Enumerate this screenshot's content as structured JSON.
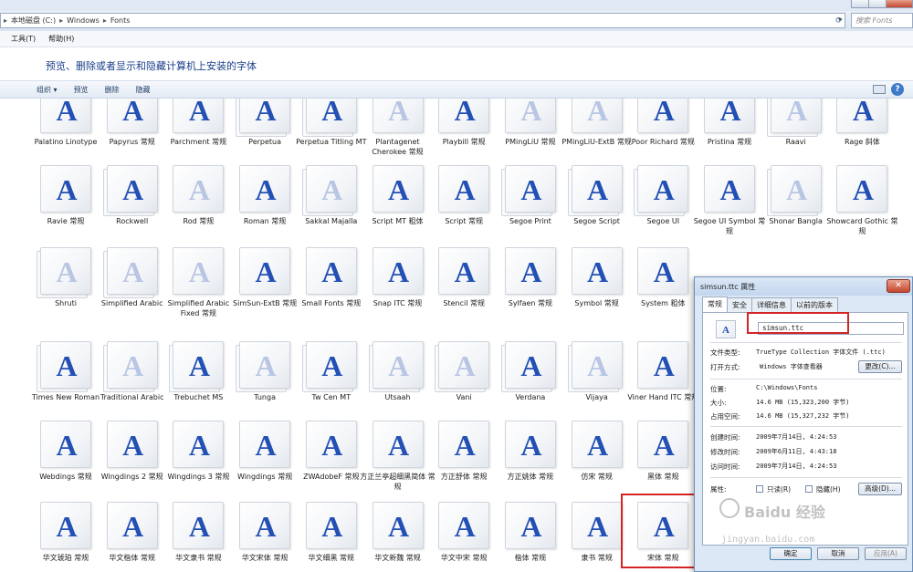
{
  "address": {
    "crumbs": [
      "本地磁盘 (C:)",
      "Windows",
      "Fonts"
    ],
    "search_placeholder": "搜索 Fonts"
  },
  "menu": [
    "工具(T)",
    "帮助(H)"
  ],
  "page_title": "预览、删除或者显示和隐藏计算机上安装的字体",
  "toolbar": {
    "organize": "组织 ▾",
    "preview": "预览",
    "delete": "删除",
    "hide": "隐藏",
    "help": "?"
  },
  "fonts": [
    {
      "name": "Palatino Linotype",
      "stack": false,
      "faded": false
    },
    {
      "name": "Papyrus 常规",
      "stack": false,
      "faded": false
    },
    {
      "name": "Parchment 常规",
      "stack": false,
      "faded": false
    },
    {
      "name": "Perpetua",
      "stack": true,
      "faded": false
    },
    {
      "name": "Perpetua Titling MT",
      "stack": true,
      "faded": false
    },
    {
      "name": "Plantagenet Cherokee 常规",
      "stack": false,
      "faded": true
    },
    {
      "name": "Playbill 常规",
      "stack": false,
      "faded": false
    },
    {
      "name": "PMingLiU 常规",
      "stack": false,
      "faded": true
    },
    {
      "name": "PMingLiU-ExtB 常规",
      "stack": false,
      "faded": true
    },
    {
      "name": "Poor Richard 常规",
      "stack": false,
      "faded": false
    },
    {
      "name": "Pristina 常规",
      "stack": false,
      "faded": false
    },
    {
      "name": "Raavi",
      "stack": true,
      "faded": true
    },
    {
      "name": "Rage 斜体",
      "stack": false,
      "faded": false
    },
    {
      "name": "Ravie 常规",
      "stack": false,
      "faded": false
    },
    {
      "name": "Rockwell",
      "stack": true,
      "faded": false
    },
    {
      "name": "Rod 常规",
      "stack": false,
      "faded": true
    },
    {
      "name": "Roman 常规",
      "stack": false,
      "faded": false
    },
    {
      "name": "Sakkal Majalla",
      "stack": true,
      "faded": true
    },
    {
      "name": "Script MT 粗体",
      "stack": false,
      "faded": false
    },
    {
      "name": "Script 常规",
      "stack": false,
      "faded": false
    },
    {
      "name": "Segoe Print",
      "stack": true,
      "faded": false
    },
    {
      "name": "Segoe Script",
      "stack": true,
      "faded": false
    },
    {
      "name": "Segoe UI",
      "stack": true,
      "faded": false
    },
    {
      "name": "Segoe UI Symbol 常规",
      "stack": false,
      "faded": false
    },
    {
      "name": "Shonar Bangla",
      "stack": true,
      "faded": true
    },
    {
      "name": "Showcard Gothic 常规",
      "stack": false,
      "faded": false
    },
    {
      "name": "Shruti",
      "stack": true,
      "faded": true
    },
    {
      "name": "Simplified Arabic",
      "stack": true,
      "faded": true
    },
    {
      "name": "Simplified Arabic Fixed 常规",
      "stack": false,
      "faded": true
    },
    {
      "name": "SimSun-ExtB 常规",
      "stack": false,
      "faded": false
    },
    {
      "name": "Small Fonts 常规",
      "stack": false,
      "faded": false
    },
    {
      "name": "Snap ITC 常规",
      "stack": false,
      "faded": false
    },
    {
      "name": "Stencil 常规",
      "stack": false,
      "faded": false
    },
    {
      "name": "Sylfaen 常规",
      "stack": false,
      "faded": false
    },
    {
      "name": "Symbol 常规",
      "stack": false,
      "faded": false
    },
    {
      "name": "System 粗体",
      "stack": false,
      "faded": false
    },
    {
      "name": "Times New Roman",
      "stack": true,
      "faded": false
    },
    {
      "name": "Traditional Arabic",
      "stack": true,
      "faded": true
    },
    {
      "name": "Trebuchet MS",
      "stack": true,
      "faded": false
    },
    {
      "name": "Tunga",
      "stack": true,
      "faded": true
    },
    {
      "name": "Tw Cen MT",
      "stack": true,
      "faded": false
    },
    {
      "name": "Utsaah",
      "stack": true,
      "faded": true
    },
    {
      "name": "Vani",
      "stack": true,
      "faded": true
    },
    {
      "name": "Verdana",
      "stack": true,
      "faded": false
    },
    {
      "name": "Vijaya",
      "stack": true,
      "faded": true
    },
    {
      "name": "Viner Hand ITC 常规",
      "stack": false,
      "faded": false
    },
    {
      "name": "Webdings 常规",
      "stack": false,
      "faded": false
    },
    {
      "name": "Wingdings 2 常规",
      "stack": false,
      "faded": false
    },
    {
      "name": "Wingdings 3 常规",
      "stack": false,
      "faded": false
    },
    {
      "name": "Wingdings 常规",
      "stack": false,
      "faded": false
    },
    {
      "name": "ZWAdobeF 常规",
      "stack": false,
      "faded": false
    },
    {
      "name": "方正兰亭超细黑简体 常规",
      "stack": false,
      "faded": false
    },
    {
      "name": "方正舒体 常规",
      "stack": false,
      "faded": false
    },
    {
      "name": "方正姚体 常规",
      "stack": false,
      "faded": false
    },
    {
      "name": "仿宋 常规",
      "stack": false,
      "faded": false
    },
    {
      "name": "黑体 常规",
      "stack": false,
      "faded": false
    },
    {
      "name": "华文琥珀 常规",
      "stack": false,
      "faded": false
    },
    {
      "name": "华文楷体 常规",
      "stack": false,
      "faded": false
    },
    {
      "name": "华文隶书 常规",
      "stack": false,
      "faded": false
    },
    {
      "name": "华文宋体 常规",
      "stack": false,
      "faded": false
    },
    {
      "name": "华文细黑 常规",
      "stack": false,
      "faded": false
    },
    {
      "name": "华文新魏 常规",
      "stack": false,
      "faded": false
    },
    {
      "name": "华文中宋 常规",
      "stack": false,
      "faded": false
    },
    {
      "name": "楷体 常规",
      "stack": false,
      "faded": false
    },
    {
      "name": "隶书 常规",
      "stack": false,
      "faded": false
    },
    {
      "name": "宋体 常规",
      "stack": false,
      "faded": false
    }
  ],
  "dialog": {
    "title": "simsun.ttc 属性",
    "close": "✕",
    "tabs": [
      "常规",
      "安全",
      "详细信息",
      "以前的版本"
    ],
    "filename": "simsun.ttc",
    "type_label": "文件类型:",
    "type_value": "TrueType Collection 字体文件 (.ttc)",
    "open_label": "打开方式:",
    "open_value": "Windows 字体查看器",
    "change_btn": "更改(C)...",
    "location_label": "位置:",
    "location_value": "C:\\Windows\\Fonts",
    "size_label": "大小:",
    "size_value": "14.6 MB (15,323,200 字节)",
    "disk_label": "占用空间:",
    "disk_value": "14.6 MB (15,327,232 字节)",
    "created_label": "创建时间:",
    "created_value": "2009年7月14日, 4:24:53",
    "modified_label": "修改时间:",
    "modified_value": "2009年6月11日, 4:43:18",
    "accessed_label": "访问时间:",
    "accessed_value": "2009年7月14日, 4:24:53",
    "attr_label": "属性:",
    "readonly_label": "只读(R)",
    "hidden_label": "隐藏(H)",
    "advanced_btn": "高级(D)...",
    "ok_btn": "确定",
    "cancel_btn": "取消",
    "apply_btn": "应用(A)"
  },
  "watermark": {
    "text": "Baidu 经验",
    "url": "jingyan.baidu.com"
  },
  "colors": {
    "glyph": "#2350b4",
    "faded_glyph": "#b9c6e3",
    "highlight": "#d32525",
    "title": "#1a3f8a"
  }
}
